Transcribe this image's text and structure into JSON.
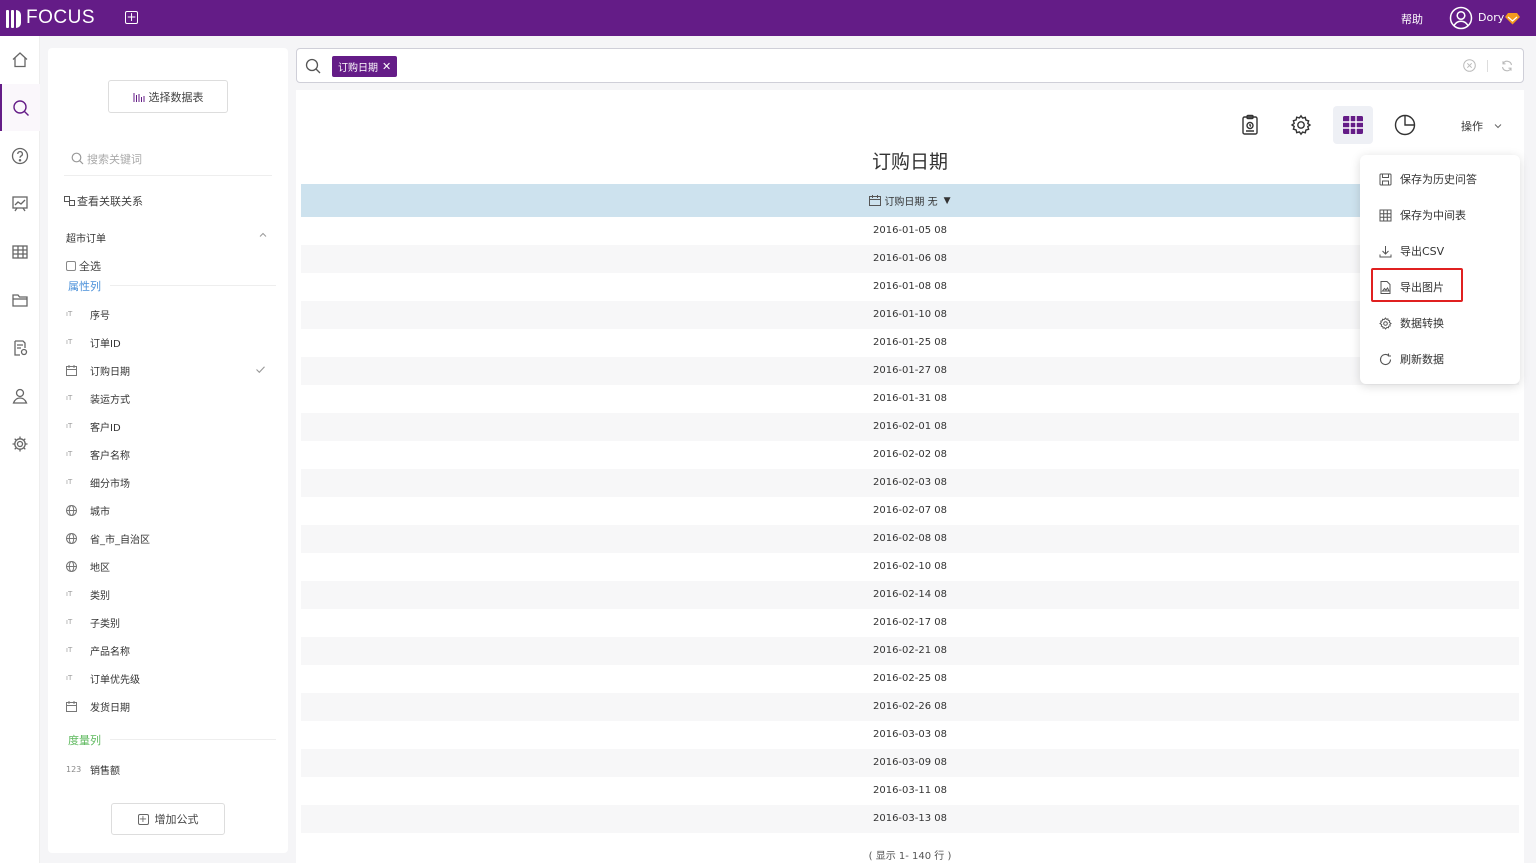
{
  "header": {
    "logo_text": "FOCUS",
    "help_label": "帮助",
    "user_name": "Dory",
    "brand_color": "#641c87"
  },
  "rail": {
    "items": [
      "home-icon",
      "search-icon",
      "help-icon",
      "dashboard-icon",
      "table-icon",
      "folder-icon",
      "report-settings-icon",
      "user-icon",
      "settings-icon"
    ],
    "active": "search-icon"
  },
  "data_panel": {
    "select_table_label": "选择数据表",
    "search_placeholder": "搜索关键词",
    "relation_label": "查看关联关系",
    "table_name": "超市订单",
    "select_all_label": "全选",
    "attribute_group_label": "属性列",
    "measure_group_label": "度量列",
    "attribute_columns": [
      {
        "label": "序号",
        "type": "text"
      },
      {
        "label": "订单ID",
        "type": "text"
      },
      {
        "label": "订购日期",
        "type": "date",
        "selected": true
      },
      {
        "label": "装运方式",
        "type": "text"
      },
      {
        "label": "客户ID",
        "type": "text"
      },
      {
        "label": "客户名称",
        "type": "text"
      },
      {
        "label": "细分市场",
        "type": "text"
      },
      {
        "label": "城市",
        "type": "geo"
      },
      {
        "label": "省_市_自治区",
        "type": "geo"
      },
      {
        "label": "地区",
        "type": "geo"
      },
      {
        "label": "类别",
        "type": "text"
      },
      {
        "label": "子类别",
        "type": "text"
      },
      {
        "label": "产品名称",
        "type": "text"
      },
      {
        "label": "订单优先级",
        "type": "text"
      },
      {
        "label": "发货日期",
        "type": "date"
      }
    ],
    "measure_columns": [
      {
        "label": "销售额",
        "type_label": "123"
      }
    ],
    "add_formula_label": "增加公式"
  },
  "search": {
    "token_label": "订购日期"
  },
  "result": {
    "ops_label": "操作",
    "title": "订购日期",
    "column_header": "订购日期 无",
    "rows": [
      "2016-01-05 08",
      "2016-01-06 08",
      "2016-01-08 08",
      "2016-01-10 08",
      "2016-01-25 08",
      "2016-01-27 08",
      "2016-01-31 08",
      "2016-02-01 08",
      "2016-02-02 08",
      "2016-02-03 08",
      "2016-02-07 08",
      "2016-02-08 08",
      "2016-02-10 08",
      "2016-02-14 08",
      "2016-02-17 08",
      "2016-02-21 08",
      "2016-02-25 08",
      "2016-02-26 08",
      "2016-03-03 08",
      "2016-03-09 08",
      "2016-03-11 08",
      "2016-03-13 08"
    ],
    "footer": "( 显示 1- 140 行 )"
  },
  "ops_menu": {
    "items": [
      {
        "label": "保存为历史问答",
        "icon": "save-icon"
      },
      {
        "label": "保存为中间表",
        "icon": "table-icon"
      },
      {
        "label": "导出CSV",
        "icon": "download-icon"
      },
      {
        "label": "导出图片",
        "icon": "image-file-icon",
        "highlighted": true
      },
      {
        "label": "数据转换",
        "icon": "gear-icon"
      },
      {
        "label": "刷新数据",
        "icon": "refresh-icon"
      }
    ],
    "highlight_color": "#e02020"
  }
}
